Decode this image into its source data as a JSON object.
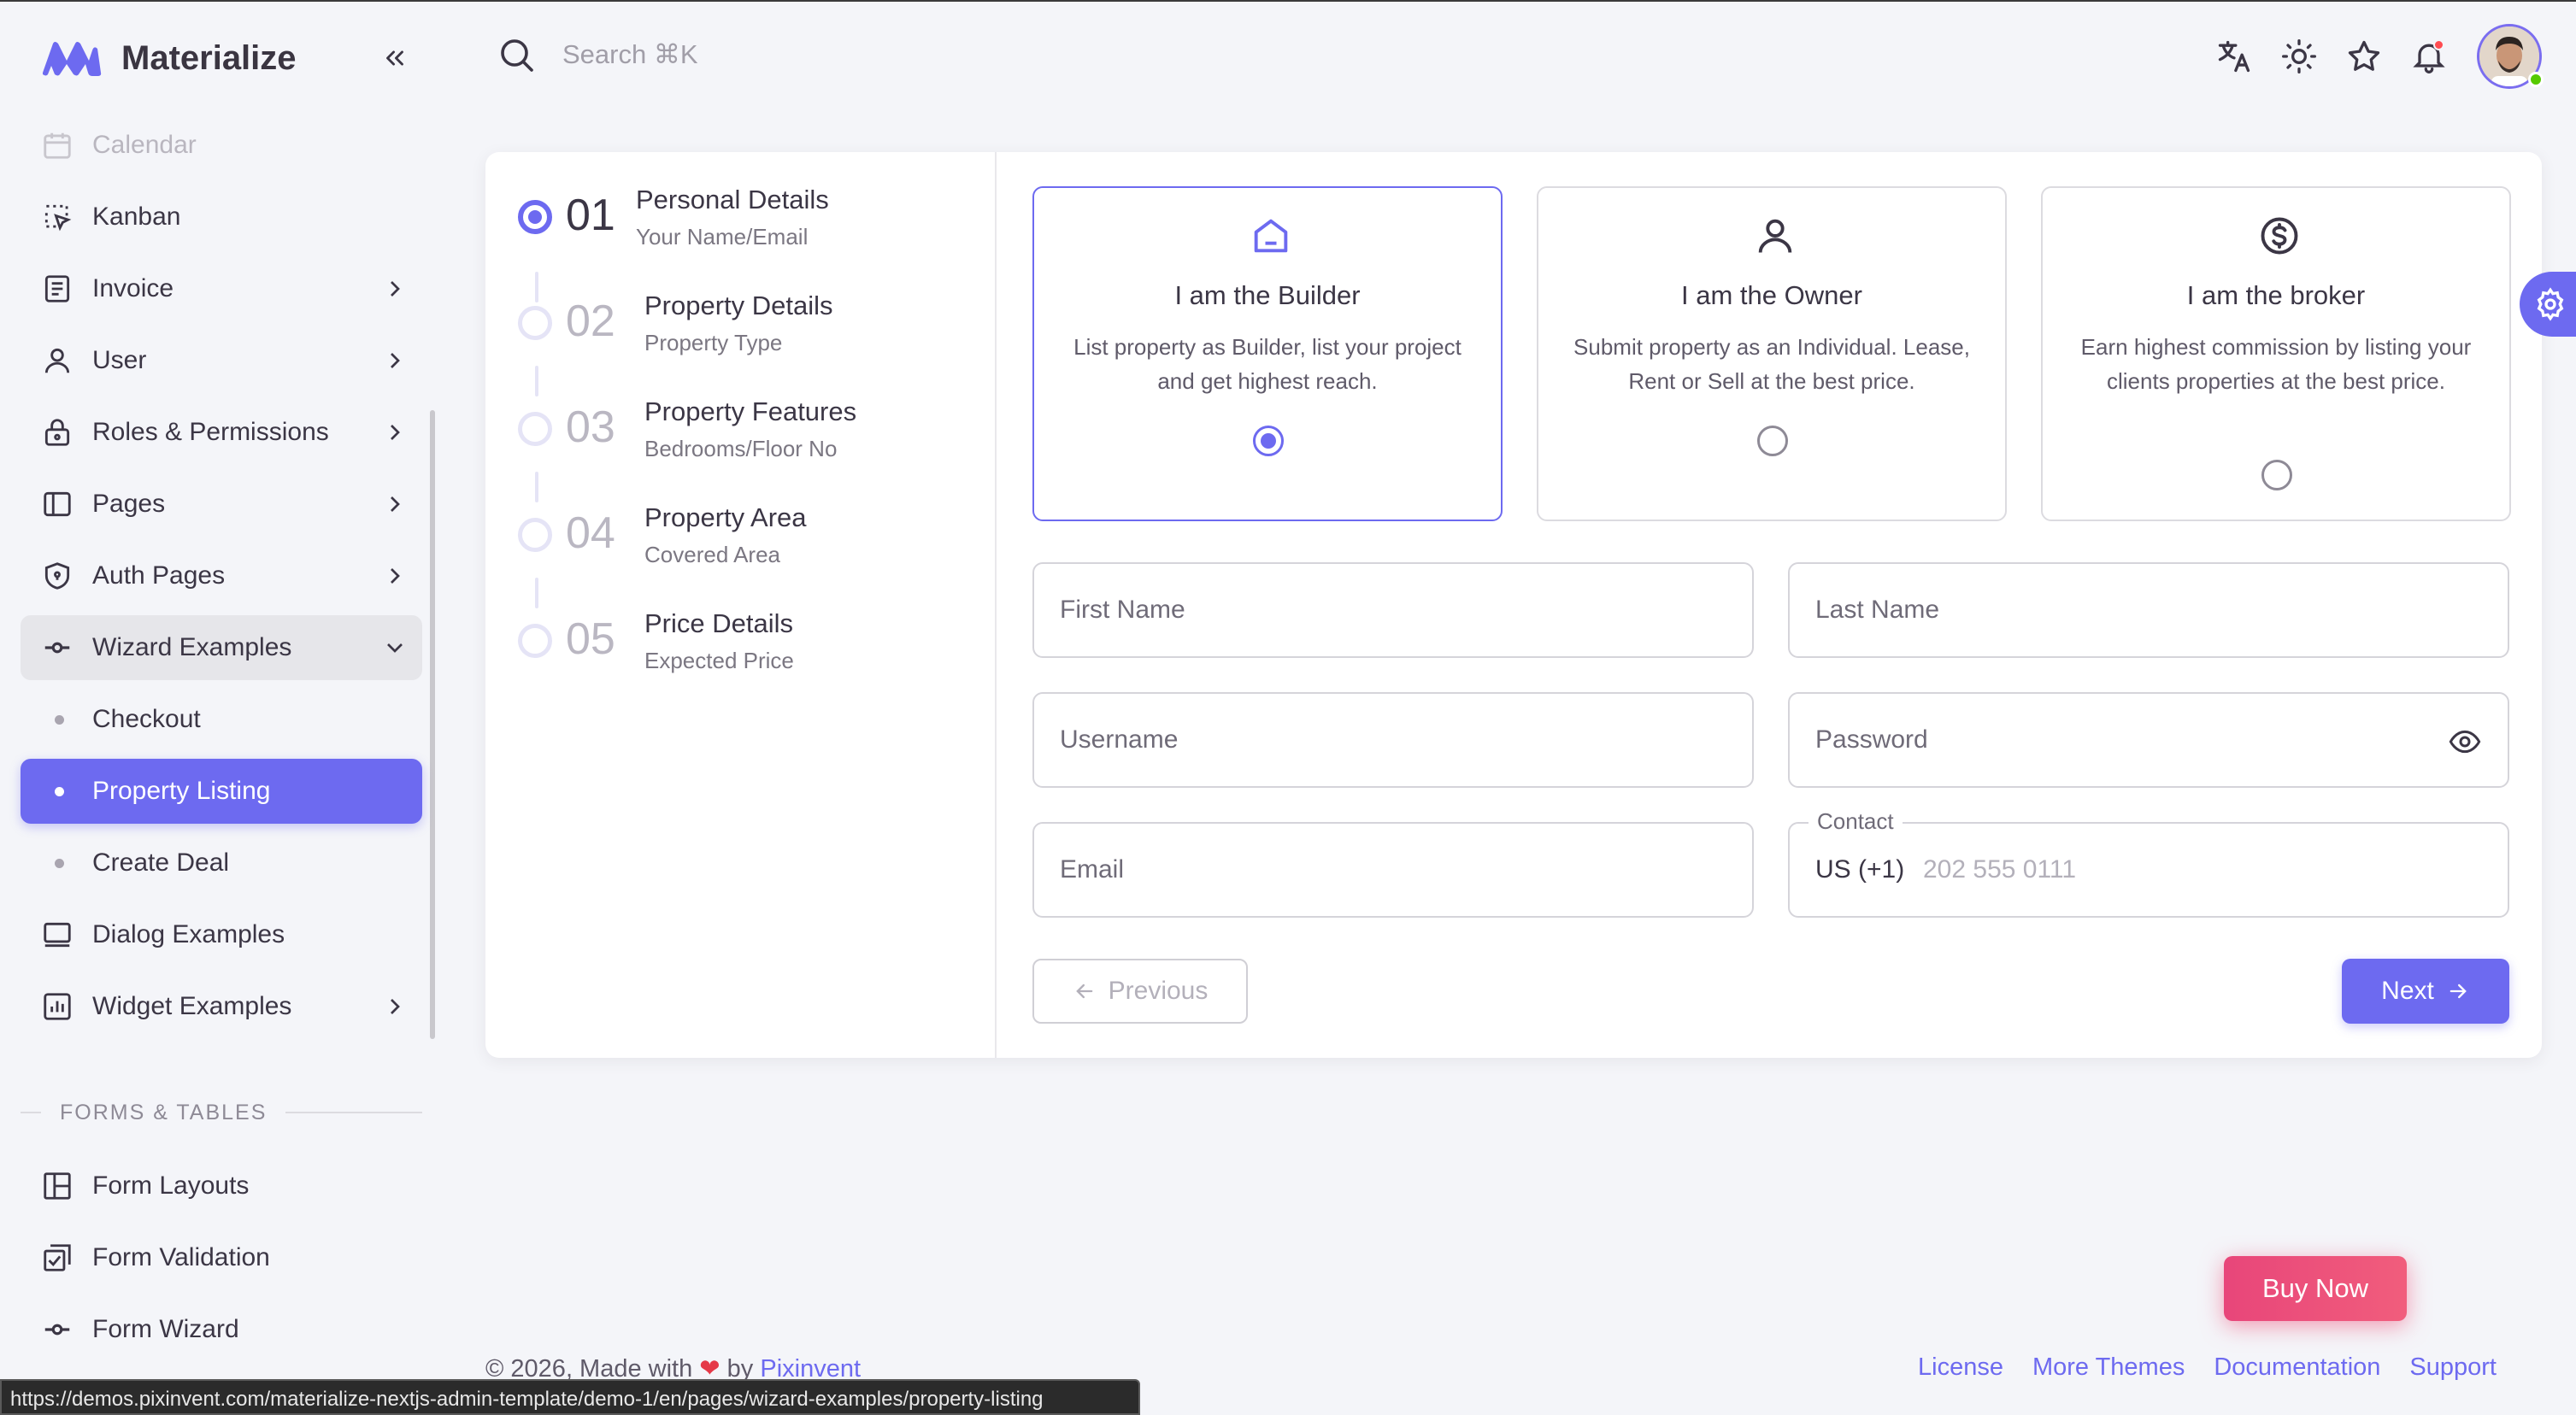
{
  "brand": {
    "name": "Materialize",
    "color": "#6d6af0"
  },
  "sidebar": {
    "items": [
      {
        "label": "Calendar",
        "icon": "calendar-icon"
      },
      {
        "label": "Kanban",
        "icon": "kanban-icon"
      },
      {
        "label": "Invoice",
        "icon": "invoice-icon",
        "has_children": true
      },
      {
        "label": "User",
        "icon": "user-icon",
        "has_children": true
      },
      {
        "label": "Roles & Permissions",
        "icon": "lock-icon",
        "has_children": true
      },
      {
        "label": "Pages",
        "icon": "layout-icon",
        "has_children": true
      },
      {
        "label": "Auth Pages",
        "icon": "shield-icon",
        "has_children": true
      },
      {
        "label": "Wizard Examples",
        "icon": "wizard-icon",
        "expanded": true
      },
      {
        "label": "Checkout"
      },
      {
        "label": "Property Listing",
        "active": true
      },
      {
        "label": "Create Deal"
      },
      {
        "label": "Dialog Examples",
        "icon": "monitor-icon"
      },
      {
        "label": "Widget Examples",
        "icon": "chart-icon",
        "has_children": true
      }
    ],
    "section_title": "FORMS & TABLES",
    "forms_items": [
      {
        "label": "Form Layouts",
        "icon": "form-layout-icon"
      },
      {
        "label": "Form Validation",
        "icon": "checkbox-icon"
      },
      {
        "label": "Form Wizard",
        "icon": "wizard-icon"
      }
    ]
  },
  "header": {
    "search_placeholder": "Search ⌘K"
  },
  "steps": [
    {
      "number": "01",
      "title": "Personal Details",
      "subtitle": "Your Name/Email",
      "active": true
    },
    {
      "number": "02",
      "title": "Property Details",
      "subtitle": "Property Type"
    },
    {
      "number": "03",
      "title": "Property Features",
      "subtitle": "Bedrooms/Floor No"
    },
    {
      "number": "04",
      "title": "Property Area",
      "subtitle": "Covered Area"
    },
    {
      "number": "05",
      "title": "Price Details",
      "subtitle": "Expected Price"
    }
  ],
  "options": [
    {
      "title": "I am the Builder",
      "description": "List property as Builder, list your project and get highest reach.",
      "icon": "home-icon",
      "selected": true
    },
    {
      "title": "I am the Owner",
      "description": "Submit property as an Individual. Lease, Rent or Sell at the best price.",
      "icon": "user-icon",
      "selected": false
    },
    {
      "title": "I am the broker",
      "description": "Earn highest commission by listing your clients properties at the best price.",
      "icon": "dollar-circle-icon",
      "selected": false
    }
  ],
  "form": {
    "first_name": "First Name",
    "last_name": "Last Name",
    "username": "Username",
    "password": "Password",
    "email": "Email",
    "contact_label": "Contact",
    "contact_prefix": "US (+1)",
    "contact_placeholder": "202 555 0111"
  },
  "buttons": {
    "previous": "Previous",
    "next": "Next",
    "buy_now": "Buy Now"
  },
  "footer": {
    "copyright": "© 2026, Made with",
    "by": "by",
    "company": "Pixinvent",
    "links": [
      "License",
      "More Themes",
      "Documentation",
      "Support"
    ]
  },
  "status_url": "https://demos.pixinvent.com/materialize-nextjs-admin-template/demo-1/en/pages/wizard-examples/property-listing"
}
